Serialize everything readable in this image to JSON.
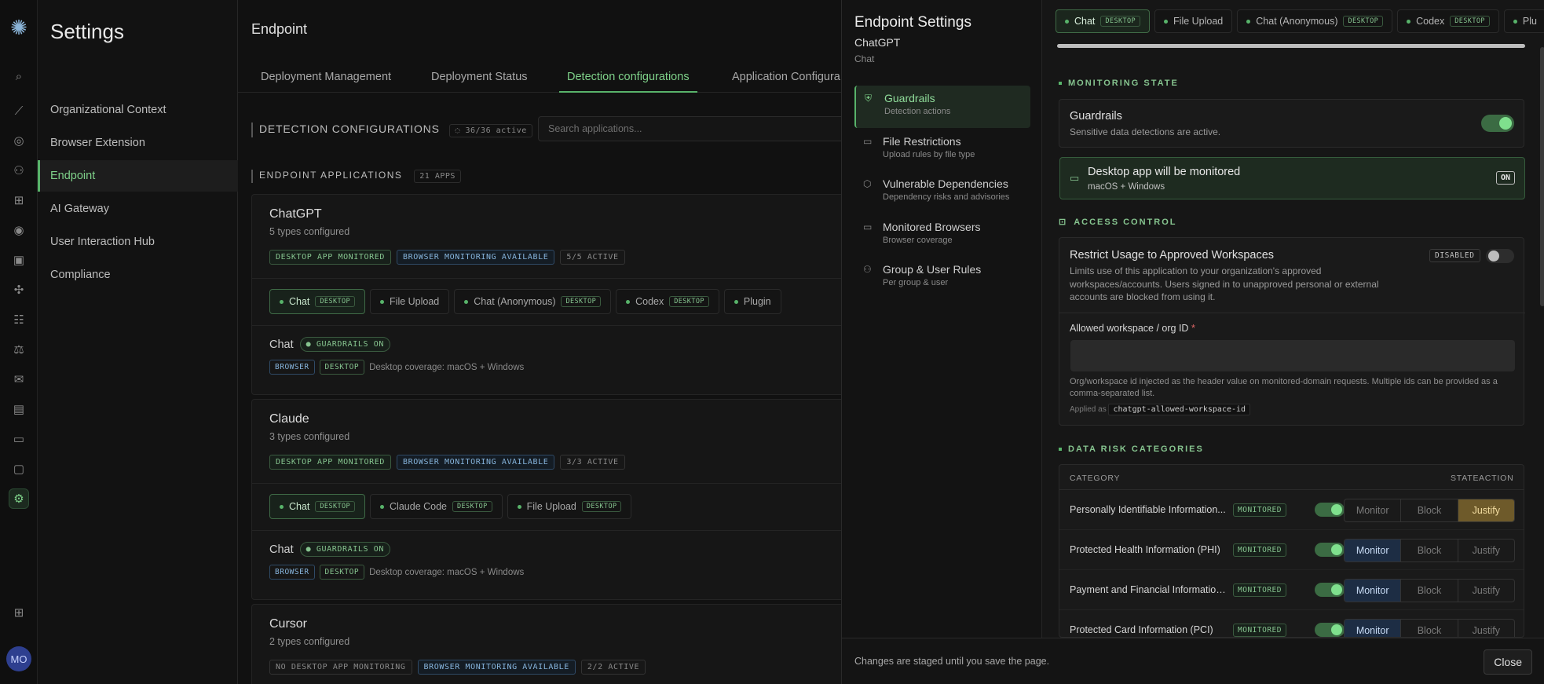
{
  "rail": {
    "avatar": "MO",
    "icons": [
      "search-icon",
      "chart-icon",
      "scan-icon",
      "users-icon",
      "grid-icon",
      "user-circle-icon",
      "ai-icon",
      "puzzle-icon",
      "team-icon",
      "scale-icon",
      "mail-icon",
      "report-icon",
      "file-icon",
      "frame-icon",
      "gear-icon",
      "apps-icon"
    ]
  },
  "settings": {
    "title": "Settings",
    "items": [
      "Organizational Context",
      "Browser Extension",
      "Endpoint",
      "AI Gateway",
      "User Interaction Hub",
      "Compliance"
    ]
  },
  "main": {
    "title": "Endpoint",
    "tabs": [
      "Deployment Management",
      "Deployment Status",
      "Detection configurations",
      "Application Configura"
    ],
    "detection": {
      "label": "DETECTION CONFIGURATIONS",
      "count": "36/36 active",
      "search_placeholder": "Search applications..."
    },
    "endpoint_apps": {
      "label": "ENDPOINT APPLICATIONS",
      "count": "21 APPS"
    },
    "cards": [
      {
        "name": "ChatGPT",
        "sub": "5 types configured",
        "tags": [
          "DESKTOP APP MONITORED",
          "BROWSER MONITORING AVAILABLE",
          "5/5 ACTIVE"
        ],
        "pills": [
          {
            "label": "Chat",
            "badge": "DESKTOP"
          },
          {
            "label": "File Upload",
            "badge": ""
          },
          {
            "label": "Chat (Anonymous)",
            "badge": "DESKTOP"
          },
          {
            "label": "Codex",
            "badge": "DESKTOP"
          },
          {
            "label": "Plugin",
            "badge": ""
          }
        ],
        "row_label": "Chat",
        "row_badge": "GUARDRAILS ON",
        "small_tags": [
          "BROWSER",
          "DESKTOP"
        ],
        "coverage": "Desktop coverage: macOS + Windows"
      },
      {
        "name": "Claude",
        "sub": "3 types configured",
        "tags": [
          "DESKTOP APP MONITORED",
          "BROWSER MONITORING AVAILABLE",
          "3/3 ACTIVE"
        ],
        "pills": [
          {
            "label": "Chat",
            "badge": "DESKTOP"
          },
          {
            "label": "Claude Code",
            "badge": "DESKTOP"
          },
          {
            "label": "File Upload",
            "badge": "DESKTOP"
          }
        ],
        "row_label": "Chat",
        "row_badge": "GUARDRAILS ON",
        "small_tags": [
          "BROWSER",
          "DESKTOP"
        ],
        "coverage": "Desktop coverage: macOS + Windows"
      },
      {
        "name": "Cursor",
        "sub": "2 types configured",
        "tags": [
          "NO DESKTOP APP MONITORING",
          "BROWSER MONITORING AVAILABLE",
          "2/2 ACTIVE"
        ]
      }
    ]
  },
  "panel": {
    "title": "Endpoint Settings",
    "app": "ChatGPT",
    "type": "Chat",
    "nav": [
      {
        "label": "Guardrails",
        "desc": "Detection actions"
      },
      {
        "label": "File Restrictions",
        "desc": "Upload rules by file type"
      },
      {
        "label": "Vulnerable Dependencies",
        "desc": "Dependency risks and advisories"
      },
      {
        "label": "Monitored Browsers",
        "desc": "Browser coverage"
      },
      {
        "label": "Group & User Rules",
        "desc": "Per group & user"
      }
    ],
    "tabs": [
      {
        "label": "Chat",
        "badge": "DESKTOP"
      },
      {
        "label": "File Upload",
        "badge": ""
      },
      {
        "label": "Chat (Anonymous)",
        "badge": "DESKTOP"
      },
      {
        "label": "Codex",
        "badge": "DESKTOP"
      },
      {
        "label": "Plu",
        "badge": ""
      }
    ],
    "monitoring": {
      "heading": "MONITORING STATE",
      "guardrails_title": "Guardrails",
      "guardrails_desc": "Sensitive data detections are active.",
      "desktop_title": "Desktop app will be monitored",
      "desktop_desc": "macOS + Windows",
      "desktop_badge": "ON"
    },
    "access": {
      "heading": "ACCESS CONTROL",
      "title": "Restrict Usage to Approved Workspaces",
      "desc": "Limits use of this application to your organization's approved workspaces/accounts. Users signed in to unapproved personal or external accounts are blocked from using it.",
      "badge": "DISABLED",
      "field_label": "Allowed workspace / org ID",
      "required": "*",
      "help": "Org/workspace id injected as the header value on monitored-domain requests. Multiple ids can be provided as a comma-separated list.",
      "applied_as": "Applied as",
      "header_name": "chatgpt-allowed-workspace-id"
    },
    "risk": {
      "heading": "DATA RISK CATEGORIES",
      "columns": [
        "CATEGORY",
        "STATE",
        "ACTION"
      ],
      "actions": [
        "Monitor",
        "Block",
        "Justify"
      ],
      "rows": [
        {
          "category": "Personally Identifiable Information...",
          "state": "MONITORED",
          "action": "Justify"
        },
        {
          "category": "Protected Health Information (PHI)",
          "state": "MONITORED",
          "action": "Monitor"
        },
        {
          "category": "Payment and Financial Information...",
          "state": "MONITORED",
          "action": "Monitor"
        },
        {
          "category": "Protected Card Information (PCI)",
          "state": "MONITORED",
          "action": "Monitor"
        }
      ]
    },
    "footer": {
      "message": "Changes are staged until you save the page.",
      "close": "Close"
    }
  }
}
